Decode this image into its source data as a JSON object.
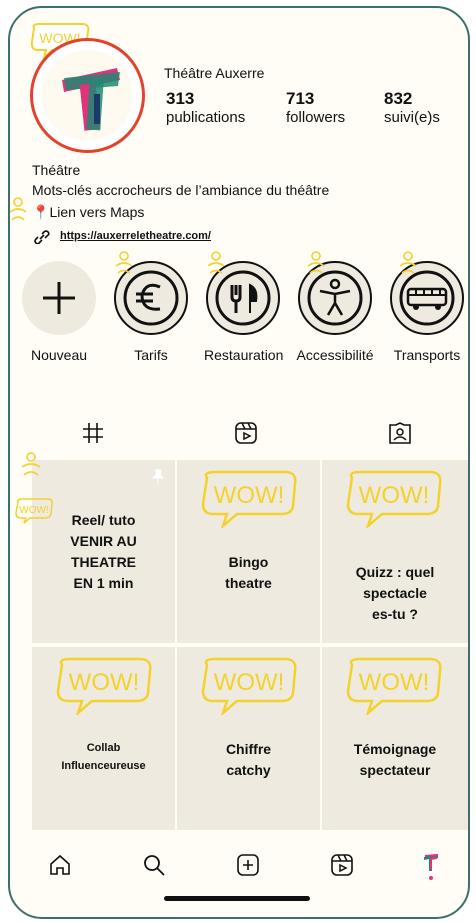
{
  "profile": {
    "account_name": "Théâtre Auxerre",
    "stats": [
      {
        "value": "313",
        "label": "publications"
      },
      {
        "value": "713",
        "label": "followers"
      },
      {
        "value": "832",
        "label": "suivi(e)s"
      }
    ],
    "category": "Théâtre",
    "bio_line": "Mots-clés accrocheurs de l’ambiance du théâtre",
    "maps_line": "Lien vers Maps",
    "website": "https://auxerreletheatre.com/",
    "wow_badge": "WOW!"
  },
  "highlights": [
    {
      "label": "Nouveau",
      "icon": "plus-icon"
    },
    {
      "label": "Tarifs",
      "icon": "euro-icon"
    },
    {
      "label": "Restauration",
      "icon": "fork-knife-icon"
    },
    {
      "label": "Accessibilité",
      "icon": "accessibility-icon"
    },
    {
      "label": "Transports",
      "icon": "bus-icon"
    }
  ],
  "tabs": [
    {
      "name": "grid-icon"
    },
    {
      "name": "reels-icon"
    },
    {
      "name": "tagged-icon"
    }
  ],
  "posts": [
    {
      "text": "Reel/ tuto\nVENIR AU\nTHEATRE\nEN 1 min",
      "wow": "",
      "pinned": true
    },
    {
      "text": "Bingo\ntheatre",
      "wow": "WOW!"
    },
    {
      "text": "Quizz : quel\nspectacle\nes-tu ?",
      "wow": "WOW!"
    },
    {
      "text": "Collab\nInfluenceureuse",
      "wow": "WOW!"
    },
    {
      "text": "Chiffre\ncatchy",
      "wow": "WOW!"
    },
    {
      "text": "Témoignage\nspectateur",
      "wow": "WOW!"
    }
  ],
  "side_badge": "WOW!",
  "bottom_nav": [
    "home-icon",
    "search-icon",
    "create-icon",
    "reels-icon",
    "profile-avatar"
  ],
  "colors": {
    "accent_yellow": "#f2d22e",
    "accent_red": "#e2432a",
    "teal": "#1e8a73",
    "pink": "#e0347a",
    "tile": "#efeadf"
  }
}
